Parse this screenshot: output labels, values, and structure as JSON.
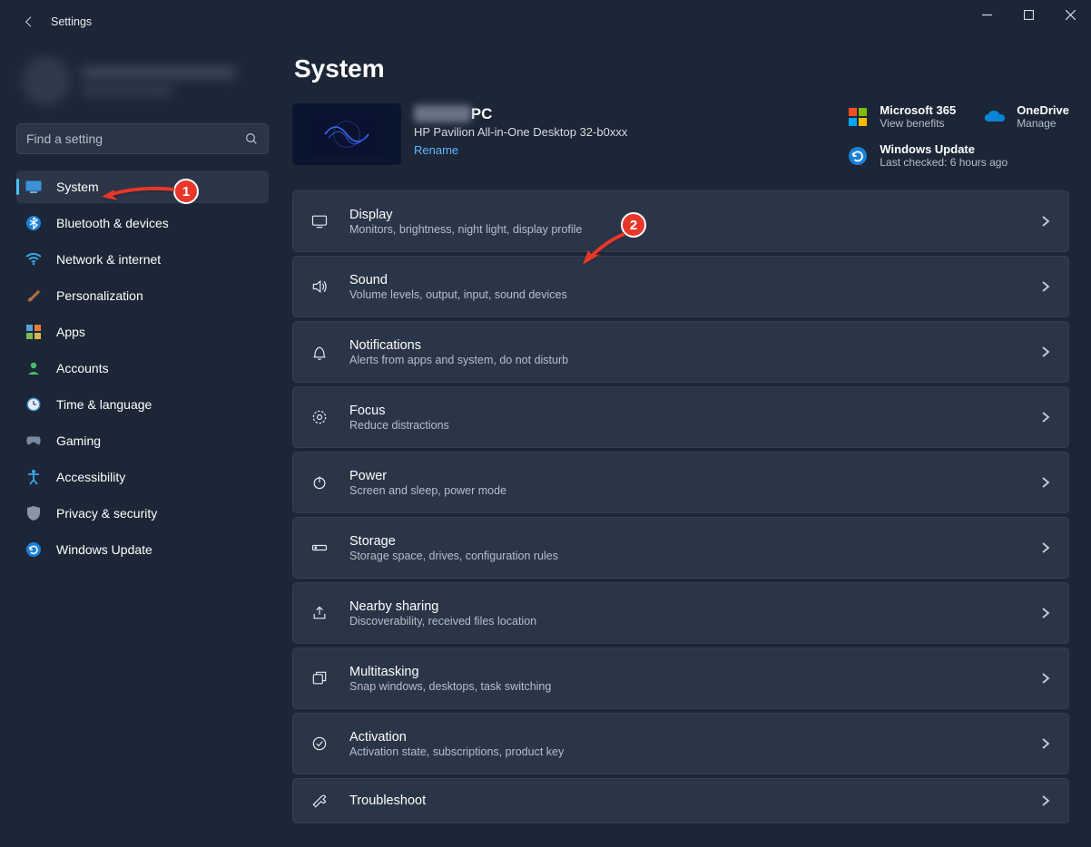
{
  "app": {
    "title": "Settings"
  },
  "search": {
    "placeholder": "Find a setting"
  },
  "sidebar": {
    "items": [
      {
        "label": "System"
      },
      {
        "label": "Bluetooth & devices"
      },
      {
        "label": "Network & internet"
      },
      {
        "label": "Personalization"
      },
      {
        "label": "Apps"
      },
      {
        "label": "Accounts"
      },
      {
        "label": "Time & language"
      },
      {
        "label": "Gaming"
      },
      {
        "label": "Accessibility"
      },
      {
        "label": "Privacy & security"
      },
      {
        "label": "Windows Update"
      }
    ]
  },
  "page": {
    "title": "System"
  },
  "device": {
    "name_suffix": "PC",
    "model": "HP Pavilion All-in-One Desktop 32-b0xxx",
    "rename": "Rename"
  },
  "quicklinks": {
    "ms365": {
      "title": "Microsoft 365",
      "sub": "View benefits"
    },
    "onedrive": {
      "title": "OneDrive",
      "sub": "Manage"
    },
    "update": {
      "title": "Windows Update",
      "sub": "Last checked: 6 hours ago"
    }
  },
  "cards": [
    {
      "title": "Display",
      "sub": "Monitors, brightness, night light, display profile"
    },
    {
      "title": "Sound",
      "sub": "Volume levels, output, input, sound devices"
    },
    {
      "title": "Notifications",
      "sub": "Alerts from apps and system, do not disturb"
    },
    {
      "title": "Focus",
      "sub": "Reduce distractions"
    },
    {
      "title": "Power",
      "sub": "Screen and sleep, power mode"
    },
    {
      "title": "Storage",
      "sub": "Storage space, drives, configuration rules"
    },
    {
      "title": "Nearby sharing",
      "sub": "Discoverability, received files location"
    },
    {
      "title": "Multitasking",
      "sub": "Snap windows, desktops, task switching"
    },
    {
      "title": "Activation",
      "sub": "Activation state, subscriptions, product key"
    },
    {
      "title": "Troubleshoot",
      "sub": ""
    }
  ],
  "anno": {
    "one": "1",
    "two": "2"
  }
}
